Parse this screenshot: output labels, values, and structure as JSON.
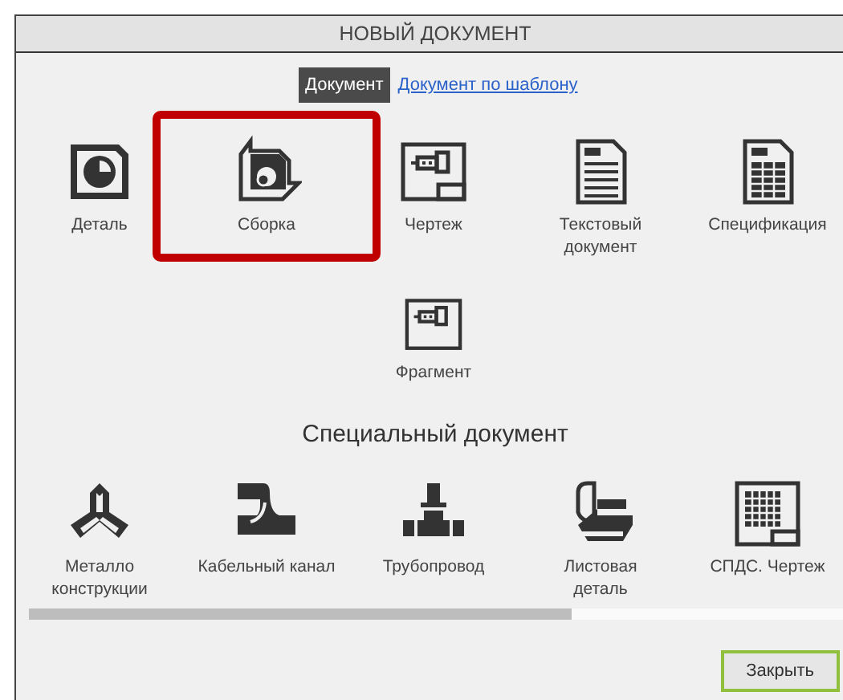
{
  "window": {
    "title": "НОВЫЙ ДОКУМЕНТ"
  },
  "tabs": [
    {
      "label": "Документ",
      "selected": true
    },
    {
      "label": "Документ по шаблону",
      "selected": false
    }
  ],
  "documents": [
    {
      "kind": "part",
      "label": "Деталь",
      "selected": false
    },
    {
      "kind": "assembly",
      "label": "Сборка",
      "selected": true
    },
    {
      "kind": "drawing",
      "label": "Чертеж",
      "selected": false
    },
    {
      "kind": "text",
      "label": "Текстовый документ",
      "selected": false
    },
    {
      "kind": "spec",
      "label": "Спецификация",
      "selected": false
    },
    {
      "kind": "fragment",
      "label": "Фрагмент",
      "selected": false
    }
  ],
  "special": {
    "title": "Специальный документ",
    "documents": [
      {
        "kind": "metal",
        "label": "Металло конструкции",
        "selected": false
      },
      {
        "kind": "cable",
        "label": "Кабельный канал",
        "selected": false
      },
      {
        "kind": "pipe",
        "label": "Трубопровод",
        "selected": false
      },
      {
        "kind": "sheet",
        "label": "Листовая деталь",
        "selected": false
      },
      {
        "kind": "spds",
        "label": "СПДС. Чертеж",
        "selected": false
      }
    ]
  },
  "buttons": [
    {
      "label": "Закрыть",
      "default": true
    }
  ]
}
